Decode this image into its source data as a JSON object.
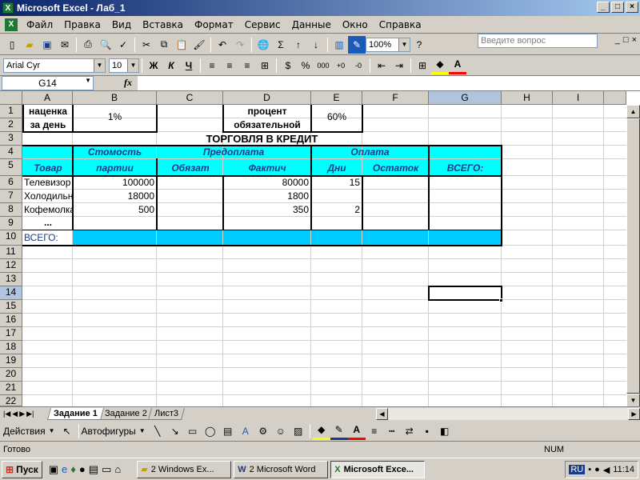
{
  "window": {
    "title": "Microsoft Excel - Лаб_1",
    "minimize": "_",
    "maximize": "□",
    "close": "×"
  },
  "menu": {
    "items": [
      "Файл",
      "Правка",
      "Вид",
      "Вставка",
      "Формат",
      "Сервис",
      "Данные",
      "Окно",
      "Справка"
    ],
    "help_placeholder": "Введите вопрос",
    "mdi": [
      "_",
      "□",
      "×"
    ]
  },
  "toolbar": {
    "zoom": "100%",
    "font": "Arial Cyr",
    "size": "10",
    "bold": "Ж",
    "italic": "К",
    "underline": "Ч",
    "percent": "%",
    "thousands": "000",
    "sigma": "Σ"
  },
  "formula": {
    "cell_ref": "G14",
    "fx": "fx",
    "value": ""
  },
  "columns": [
    "A",
    "B",
    "C",
    "D",
    "E",
    "F",
    "G",
    "H",
    "I"
  ],
  "rows": [
    "1",
    "2",
    "3",
    "4",
    "5",
    "6",
    "7",
    "8",
    "9",
    "10",
    "11",
    "12",
    "13",
    "14",
    "15",
    "16",
    "17",
    "18",
    "19",
    "20",
    "21",
    "22"
  ],
  "sheet": {
    "a1": "наценка",
    "a2": "за день",
    "b12": "1%",
    "d1": "процент",
    "d2": "обязательной",
    "e12": "60%",
    "title": "ТОРГОВЛЯ В КРЕДИТ",
    "h_cost_1": "Стомость",
    "h_cost_2": "партии",
    "h_prepay": "Предоплата",
    "h_req": "Обязат",
    "h_fact": "Фактич",
    "h_pay": "Оплата",
    "h_days": "Дни",
    "h_rest": "Остаток",
    "h_total": "ВСЕГО:",
    "h_product": "Товар",
    "r6": {
      "a": "Телевизор",
      "b": "100000",
      "d": "80000",
      "e": "15"
    },
    "r7": {
      "a": "Холодильник",
      "b": "18000",
      "d": "1800"
    },
    "r8": {
      "a": "Кофемолка",
      "b": "500",
      "d": "350",
      "e": "2"
    },
    "r9_a": "...",
    "r10_a": "ВСЕГО:"
  },
  "tabs": [
    "Задание 1",
    "Задание 2",
    "Лист3"
  ],
  "drawing": {
    "actions": "Действия",
    "autoshapes": "Автофигуры"
  },
  "status": {
    "ready": "Готово",
    "num": "NUM"
  },
  "taskbar": {
    "start": "Пуск",
    "tasks": [
      "2 Windows Ex...",
      "2 Microsoft Word",
      "Microsoft Exce..."
    ],
    "lang": "RU",
    "time": "11:14"
  },
  "colors": {
    "cyan": "#00ffff",
    "total_row": "#00ccff",
    "title_bar": "#0a246a"
  }
}
